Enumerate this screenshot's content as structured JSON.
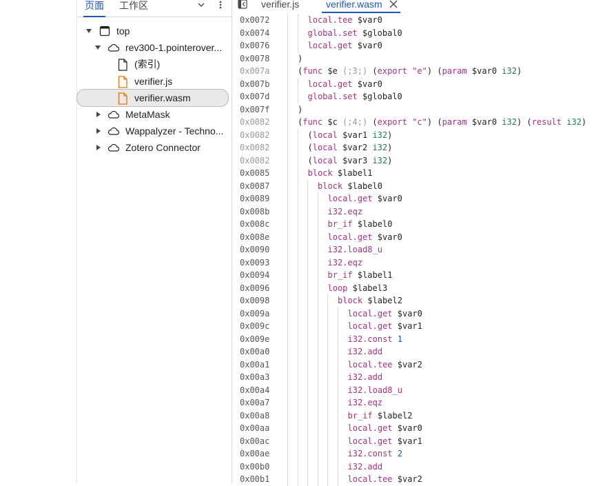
{
  "navigator": {
    "tabs": [
      "页面",
      "工作区"
    ],
    "tree": [
      {
        "label": "top",
        "depth": 0,
        "expanded": true,
        "icon": "frame-icon"
      },
      {
        "label": "rev300-1.pointerover...",
        "depth": 1,
        "expanded": true,
        "icon": "cloud-icon"
      },
      {
        "label": "(索引)",
        "depth": 2,
        "icon": "file-icon"
      },
      {
        "label": "verifier.js",
        "depth": 2,
        "icon": "script-file-icon"
      },
      {
        "label": "verifier.wasm",
        "depth": 2,
        "icon": "script-file-icon",
        "selected": true
      },
      {
        "label": "MetaMask",
        "depth": 1,
        "expanded": false,
        "icon": "cloud-icon"
      },
      {
        "label": "Wappalyzer - Techno...",
        "depth": 1,
        "expanded": false,
        "icon": "cloud-icon"
      },
      {
        "label": "Zotero Connector",
        "depth": 1,
        "expanded": false,
        "icon": "cloud-icon"
      }
    ]
  },
  "editor": {
    "tabs": [
      {
        "label": "verifier.js",
        "active": false
      },
      {
        "label": "verifier.wasm",
        "active": true
      }
    ],
    "lines": [
      {
        "addr": "0x0072",
        "dim": false,
        "indent": 1,
        "tokens": [
          [
            "k",
            "local.tee"
          ],
          [
            "v",
            " $var0"
          ]
        ]
      },
      {
        "addr": "0x0074",
        "dim": false,
        "indent": 1,
        "tokens": [
          [
            "k",
            "global.set"
          ],
          [
            "v",
            " $global0"
          ]
        ]
      },
      {
        "addr": "0x0076",
        "dim": false,
        "indent": 1,
        "tokens": [
          [
            "k",
            "local.get"
          ],
          [
            "v",
            " $var0"
          ]
        ]
      },
      {
        "addr": "0x0078",
        "dim": false,
        "indent": 0,
        "tokens": [
          [
            "p",
            ")"
          ]
        ]
      },
      {
        "addr": "0x007a",
        "dim": true,
        "indent": 0,
        "tokens": [
          [
            "p",
            "("
          ],
          [
            "k",
            "func"
          ],
          [
            "v",
            " $e "
          ],
          [
            "c",
            "(;3;)"
          ],
          [
            "p",
            " ("
          ],
          [
            "k",
            "export"
          ],
          [
            "s",
            " \"e\""
          ],
          [
            "p",
            ") ("
          ],
          [
            "k",
            "param"
          ],
          [
            "v",
            " $var0 "
          ],
          [
            "t",
            "i32"
          ],
          [
            "p",
            ")"
          ]
        ]
      },
      {
        "addr": "0x007b",
        "dim": false,
        "indent": 1,
        "tokens": [
          [
            "k",
            "local.get"
          ],
          [
            "v",
            " $var0"
          ]
        ]
      },
      {
        "addr": "0x007d",
        "dim": false,
        "indent": 1,
        "tokens": [
          [
            "k",
            "global.set"
          ],
          [
            "v",
            " $global0"
          ]
        ]
      },
      {
        "addr": "0x007f",
        "dim": false,
        "indent": 0,
        "tokens": [
          [
            "p",
            ")"
          ]
        ]
      },
      {
        "addr": "0x0082",
        "dim": true,
        "indent": 0,
        "tokens": [
          [
            "p",
            "("
          ],
          [
            "k",
            "func"
          ],
          [
            "v",
            " $c "
          ],
          [
            "c",
            "(;4;)"
          ],
          [
            "p",
            " ("
          ],
          [
            "k",
            "export"
          ],
          [
            "s",
            " \"c\""
          ],
          [
            "p",
            ") ("
          ],
          [
            "k",
            "param"
          ],
          [
            "v",
            " $var0 "
          ],
          [
            "t",
            "i32"
          ],
          [
            "p",
            ") ("
          ],
          [
            "k",
            "result"
          ],
          [
            "t",
            " i32"
          ],
          [
            "p",
            ")"
          ]
        ]
      },
      {
        "addr": "0x0082",
        "dim": true,
        "indent": 1,
        "tokens": [
          [
            "p",
            "("
          ],
          [
            "k",
            "local"
          ],
          [
            "v",
            " $var1 "
          ],
          [
            "t",
            "i32"
          ],
          [
            "p",
            ")"
          ]
        ]
      },
      {
        "addr": "0x0082",
        "dim": true,
        "indent": 1,
        "tokens": [
          [
            "p",
            "("
          ],
          [
            "k",
            "local"
          ],
          [
            "v",
            " $var2 "
          ],
          [
            "t",
            "i32"
          ],
          [
            "p",
            ")"
          ]
        ]
      },
      {
        "addr": "0x0082",
        "dim": true,
        "indent": 1,
        "tokens": [
          [
            "p",
            "("
          ],
          [
            "k",
            "local"
          ],
          [
            "v",
            " $var3 "
          ],
          [
            "t",
            "i32"
          ],
          [
            "p",
            ")"
          ]
        ]
      },
      {
        "addr": "0x0085",
        "dim": false,
        "indent": 1,
        "tokens": [
          [
            "k",
            "block"
          ],
          [
            "v",
            " $label1"
          ]
        ]
      },
      {
        "addr": "0x0087",
        "dim": false,
        "indent": 2,
        "tokens": [
          [
            "k",
            "block"
          ],
          [
            "v",
            " $label0"
          ]
        ]
      },
      {
        "addr": "0x0089",
        "dim": false,
        "indent": 3,
        "tokens": [
          [
            "k",
            "local.get"
          ],
          [
            "v",
            " $var0"
          ]
        ]
      },
      {
        "addr": "0x008b",
        "dim": false,
        "indent": 3,
        "tokens": [
          [
            "k",
            "i32.eqz"
          ]
        ]
      },
      {
        "addr": "0x008c",
        "dim": false,
        "indent": 3,
        "tokens": [
          [
            "k",
            "br_if"
          ],
          [
            "v",
            " $label0"
          ]
        ]
      },
      {
        "addr": "0x008e",
        "dim": false,
        "indent": 3,
        "tokens": [
          [
            "k",
            "local.get"
          ],
          [
            "v",
            " $var0"
          ]
        ]
      },
      {
        "addr": "0x0090",
        "dim": false,
        "indent": 3,
        "tokens": [
          [
            "k",
            "i32.load8_u"
          ]
        ]
      },
      {
        "addr": "0x0093",
        "dim": false,
        "indent": 3,
        "tokens": [
          [
            "k",
            "i32.eqz"
          ]
        ]
      },
      {
        "addr": "0x0094",
        "dim": false,
        "indent": 3,
        "tokens": [
          [
            "k",
            "br_if"
          ],
          [
            "v",
            " $label1"
          ]
        ]
      },
      {
        "addr": "0x0096",
        "dim": false,
        "indent": 3,
        "tokens": [
          [
            "k",
            "loop"
          ],
          [
            "v",
            " $label3"
          ]
        ]
      },
      {
        "addr": "0x0098",
        "dim": false,
        "indent": 4,
        "tokens": [
          [
            "k",
            "block"
          ],
          [
            "v",
            " $label2"
          ]
        ]
      },
      {
        "addr": "0x009a",
        "dim": false,
        "indent": 5,
        "tokens": [
          [
            "k",
            "local.get"
          ],
          [
            "v",
            " $var0"
          ]
        ]
      },
      {
        "addr": "0x009c",
        "dim": false,
        "indent": 5,
        "tokens": [
          [
            "k",
            "local.get"
          ],
          [
            "v",
            " $var1"
          ]
        ]
      },
      {
        "addr": "0x009e",
        "dim": false,
        "indent": 5,
        "tokens": [
          [
            "k",
            "i32.const"
          ],
          [
            "n",
            " 1"
          ]
        ]
      },
      {
        "addr": "0x00a0",
        "dim": false,
        "indent": 5,
        "tokens": [
          [
            "k",
            "i32.add"
          ]
        ]
      },
      {
        "addr": "0x00a1",
        "dim": false,
        "indent": 5,
        "tokens": [
          [
            "k",
            "local.tee"
          ],
          [
            "v",
            " $var2"
          ]
        ]
      },
      {
        "addr": "0x00a3",
        "dim": false,
        "indent": 5,
        "tokens": [
          [
            "k",
            "i32.add"
          ]
        ]
      },
      {
        "addr": "0x00a4",
        "dim": false,
        "indent": 5,
        "tokens": [
          [
            "k",
            "i32.load8_u"
          ]
        ]
      },
      {
        "addr": "0x00a7",
        "dim": false,
        "indent": 5,
        "tokens": [
          [
            "k",
            "i32.eqz"
          ]
        ]
      },
      {
        "addr": "0x00a8",
        "dim": false,
        "indent": 5,
        "tokens": [
          [
            "k",
            "br_if"
          ],
          [
            "v",
            " $label2"
          ]
        ]
      },
      {
        "addr": "0x00aa",
        "dim": false,
        "indent": 5,
        "tokens": [
          [
            "k",
            "local.get"
          ],
          [
            "v",
            " $var0"
          ]
        ]
      },
      {
        "addr": "0x00ac",
        "dim": false,
        "indent": 5,
        "tokens": [
          [
            "k",
            "local.get"
          ],
          [
            "v",
            " $var1"
          ]
        ]
      },
      {
        "addr": "0x00ae",
        "dim": false,
        "indent": 5,
        "tokens": [
          [
            "k",
            "i32.const"
          ],
          [
            "n",
            " 2"
          ]
        ]
      },
      {
        "addr": "0x00b0",
        "dim": false,
        "indent": 5,
        "tokens": [
          [
            "k",
            "i32.add"
          ]
        ]
      },
      {
        "addr": "0x00b1",
        "dim": false,
        "indent": 5,
        "tokens": [
          [
            "k",
            "local.tee"
          ],
          [
            "v",
            " $var2"
          ]
        ]
      }
    ]
  },
  "colors": {
    "accent": "#1a56c4",
    "keyword": "#a8307f",
    "type": "#1f7a4f",
    "number": "#1a56c4",
    "comment": "#999999",
    "file_icon_orange": "#e8710a"
  }
}
